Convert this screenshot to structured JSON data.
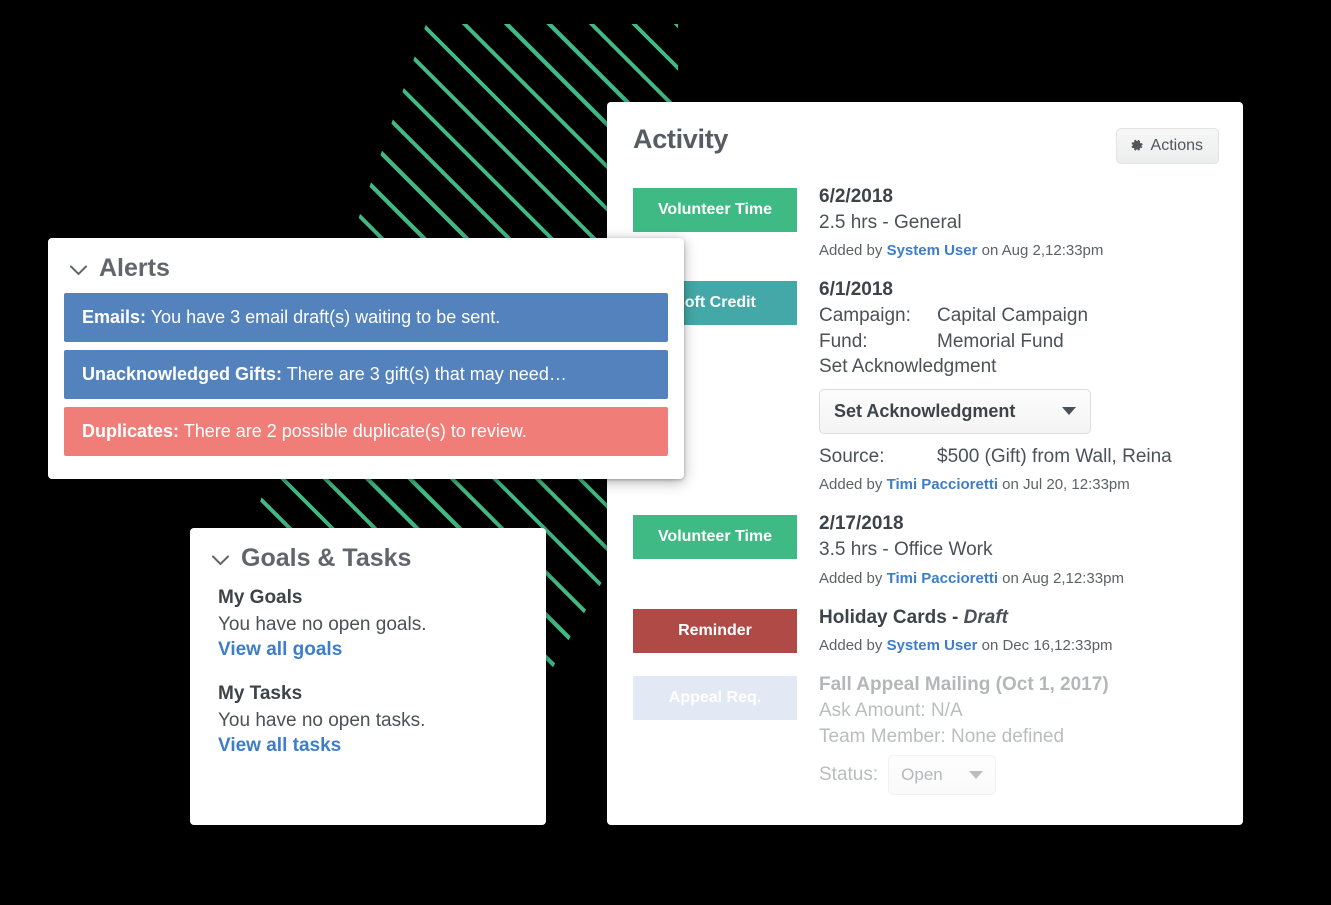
{
  "colors": {
    "background": "#000000",
    "stripe_green": "#3fba84",
    "badge_green": "#3fba84",
    "badge_teal": "#45a8a8",
    "badge_red": "#b04a46",
    "badge_blue": "#b4c8e4",
    "alert_info": "#5382bd",
    "alert_danger": "#f07d77",
    "link_blue": "#3d7dca"
  },
  "activity": {
    "title": "Activity",
    "actions_label": "Actions",
    "actions_icon": "gear-icon",
    "rows": [
      {
        "badge": "Volunteer Time",
        "badge_color": "green",
        "date": "6/2/2018",
        "detail": "2.5 hrs - General",
        "added_prefix": "Added by ",
        "added_user": "System User",
        "added_suffix": " on Aug 2,12:33pm"
      },
      {
        "badge": "Soft Credit",
        "badge_color": "teal",
        "date": "6/1/2018",
        "fields": [
          {
            "key": "Campaign:",
            "value": "Capital Campaign"
          },
          {
            "key": "Fund:",
            "value": "Memorial Fund"
          }
        ],
        "ack_text": "Set Acknowledgment",
        "ack_select_value": "Set Acknowledgment",
        "source_key": "Source:",
        "source_value": "$500 (Gift) from Wall, Reina",
        "added_prefix": "Added by ",
        "added_user": "Timi Paccioretti",
        "added_suffix": " on Jul 20, 12:33pm"
      },
      {
        "badge": "Volunteer Time",
        "badge_color": "green",
        "date": "2/17/2018",
        "detail": "3.5 hrs - Office Work",
        "added_prefix": "Added by ",
        "added_user": "Timi Paccioretti",
        "added_suffix": " on Aug 2,12:33pm"
      },
      {
        "badge": "Reminder",
        "badge_color": "red",
        "title_main": "Holiday Cards - ",
        "title_italic": "Draft",
        "added_prefix": "Added by ",
        "added_user": "System User",
        "added_suffix": " on Dec 16,12:33pm"
      },
      {
        "badge": "Appeal Req.",
        "badge_color": "blue",
        "title_main": "Fall Appeal Mailing (Oct 1, 2017)",
        "ask_amount": "Ask Amount: N/A",
        "team_member": "Team Member: None defined",
        "status_label": "Status:",
        "status_value": "Open"
      }
    ]
  },
  "alerts": {
    "title": "Alerts",
    "collapse_icon": "chevron-down-icon",
    "items": [
      {
        "label": "Emails:",
        "text": " You have 3 email draft(s) waiting to be sent.",
        "kind": "info"
      },
      {
        "label": "Unacknowledged Gifts:",
        "text": " There are 3 gift(s) that may need…",
        "kind": "info"
      },
      {
        "label": "Duplicates:",
        "text": " There are 2 possible duplicate(s) to review.",
        "kind": "danger"
      }
    ]
  },
  "goals": {
    "title": "Goals & Tasks",
    "collapse_icon": "chevron-down-icon",
    "groups": [
      {
        "heading": "My Goals",
        "text": "You have no open goals.",
        "link": "View all goals"
      },
      {
        "heading": "My Tasks",
        "text": "You have no open tasks.",
        "link": "View all tasks"
      }
    ]
  }
}
